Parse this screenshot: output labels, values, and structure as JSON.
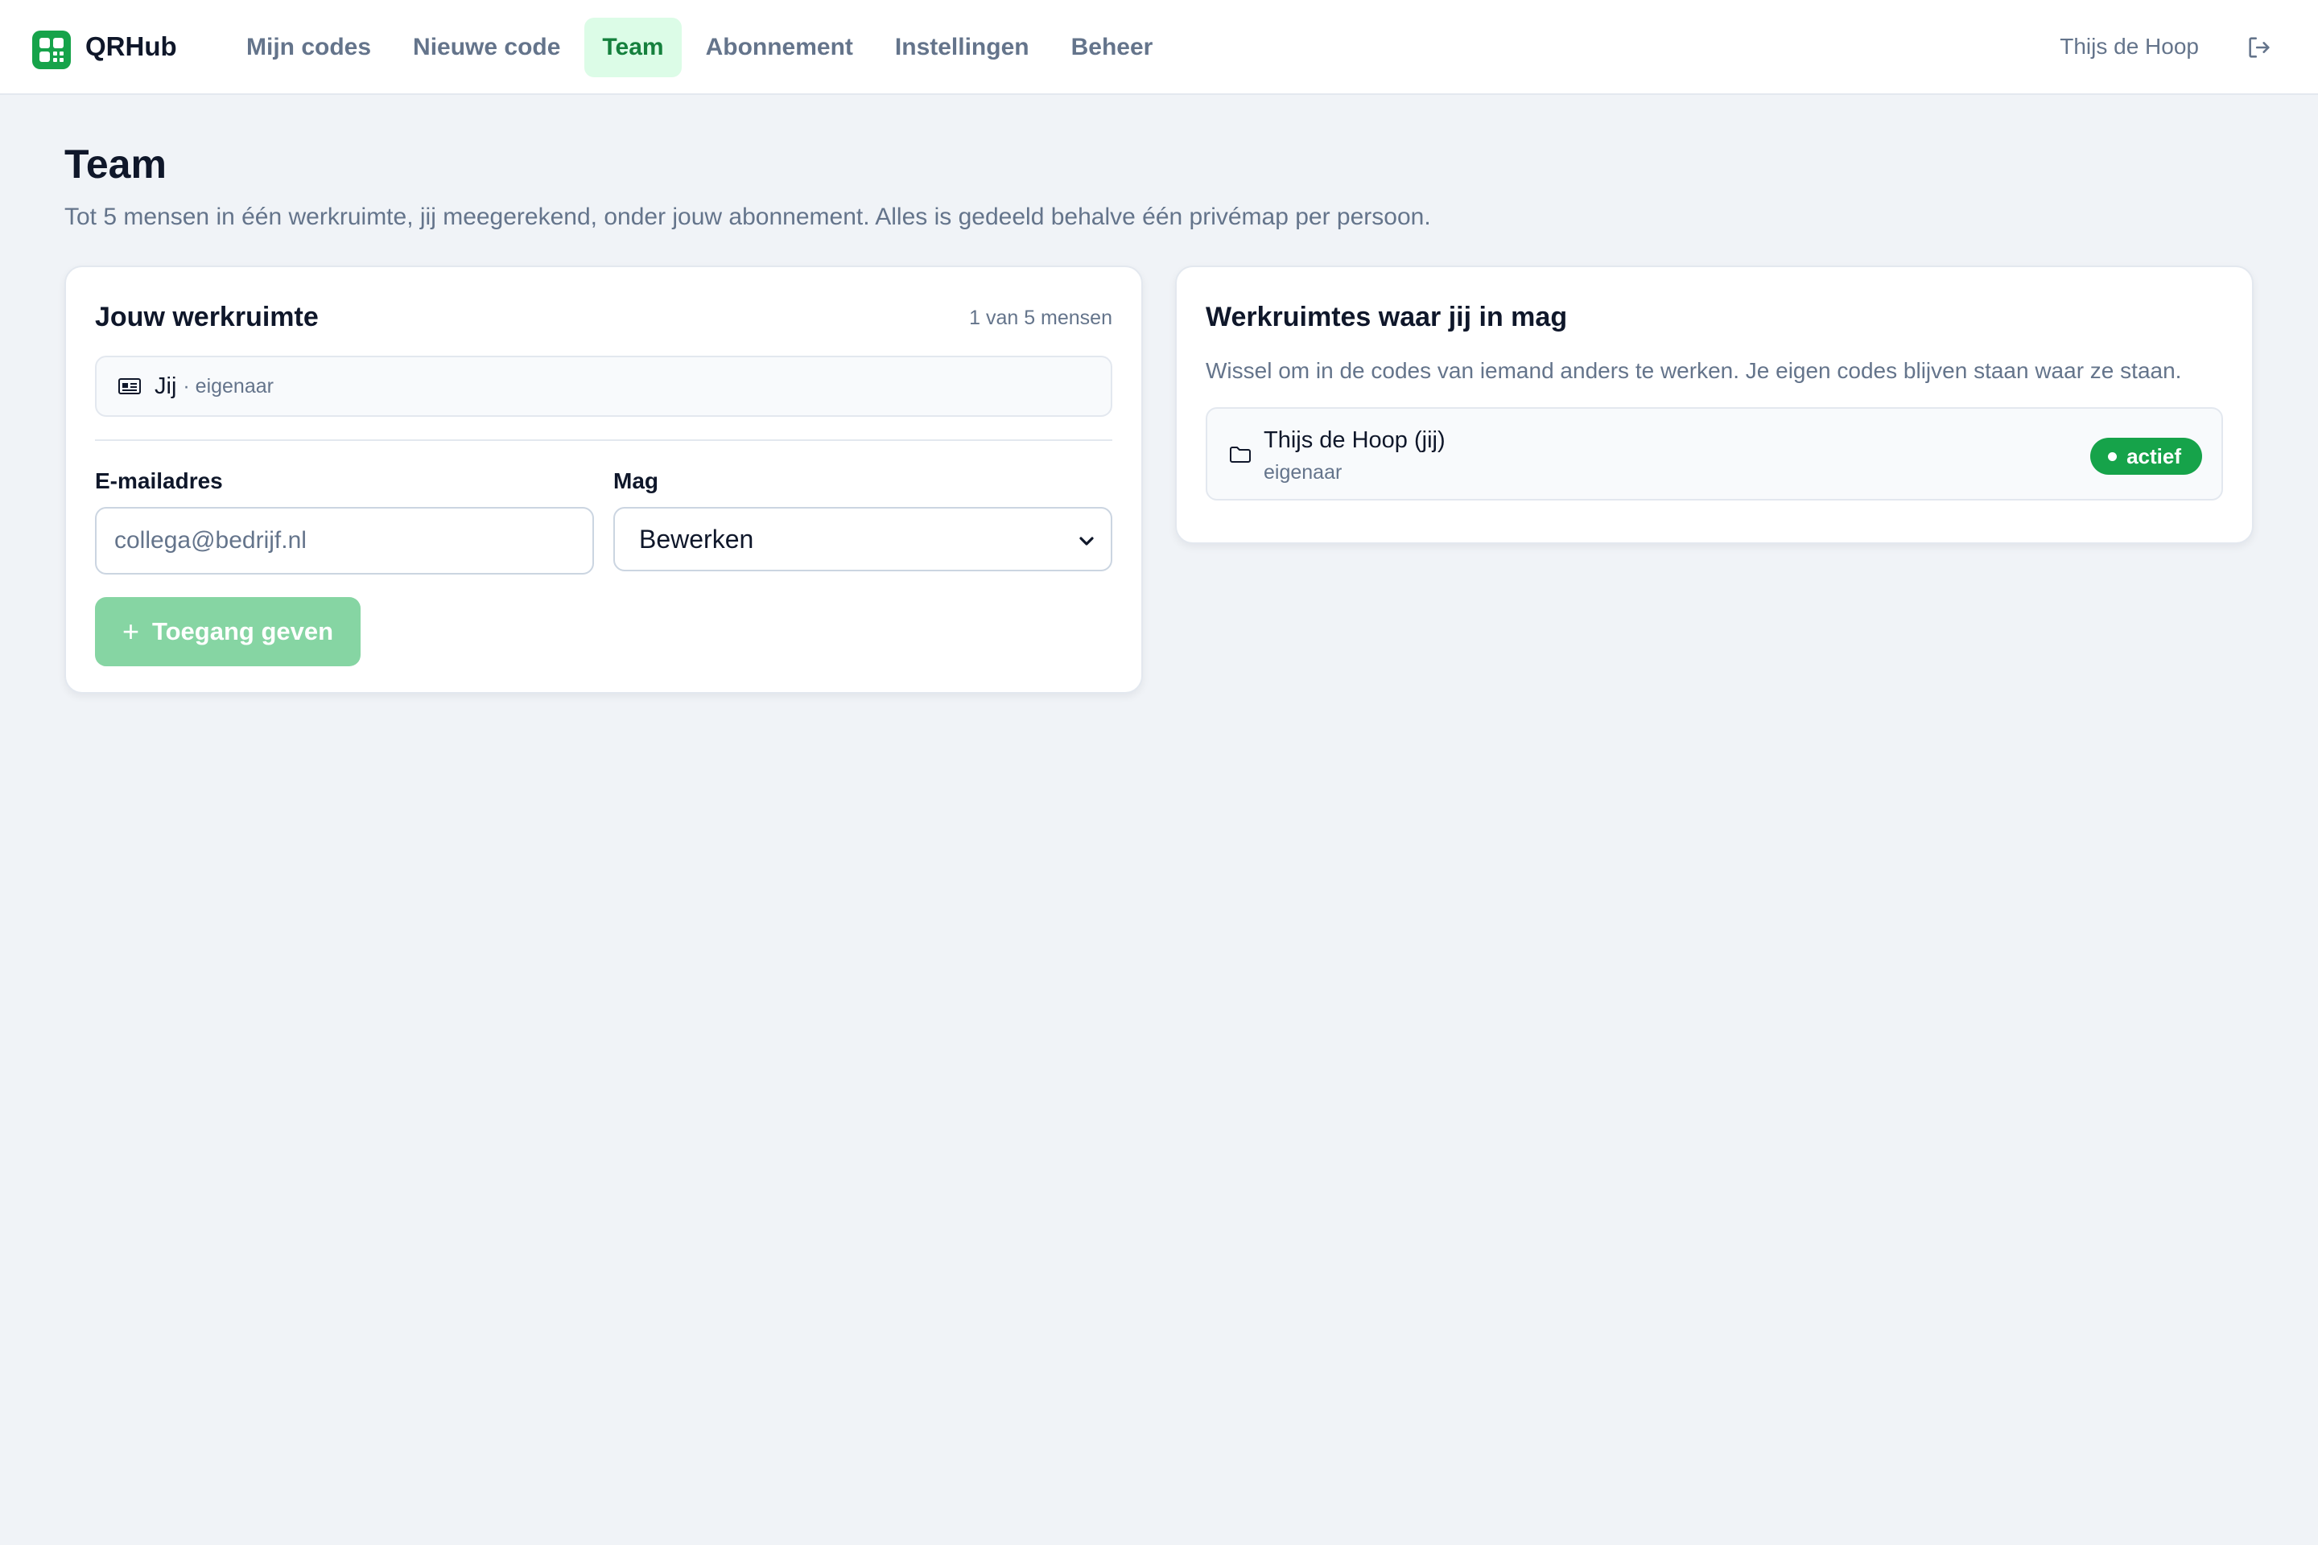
{
  "app": {
    "brand": "QRHub",
    "accent": "#16a34a"
  },
  "nav": {
    "items": [
      {
        "label": "Mijn codes",
        "active": false
      },
      {
        "label": "Nieuwe code",
        "active": false
      },
      {
        "label": "Team",
        "active": true
      },
      {
        "label": "Abonnement",
        "active": false
      },
      {
        "label": "Instellingen",
        "active": false
      },
      {
        "label": "Beheer",
        "active": false
      }
    ]
  },
  "user": {
    "name": "Thijs de Hoop",
    "logout_icon": "logout-icon"
  },
  "page": {
    "title": "Team",
    "subtitle": "Tot 5 mensen in één werkruimte, jij meegerekend, onder jouw abonnement. Alles is gedeeld behalve één privémap per persoon."
  },
  "workspace": {
    "title": "Jouw werkruimte",
    "count": "1 van 5 mensen",
    "members": [
      {
        "name": "Jij",
        "role": "· eigenaar",
        "icon": "id-card-icon"
      }
    ],
    "form": {
      "email_label": "E-mailadres",
      "email_placeholder": "collega@bedrijf.nl",
      "email_value": "",
      "permission_label": "Mag",
      "permission_value": "Bewerken",
      "submit_label": "Toegang geven"
    }
  },
  "access": {
    "title": "Werkruimtes waar jij in mag",
    "description": "Wissel om in de codes van iemand anders te werken. Je eigen codes blijven staan waar ze staan.",
    "workspaces": [
      {
        "name": "Thijs de Hoop (jij)",
        "role": "eigenaar",
        "status": "actief",
        "icon": "folder-icon"
      }
    ]
  }
}
